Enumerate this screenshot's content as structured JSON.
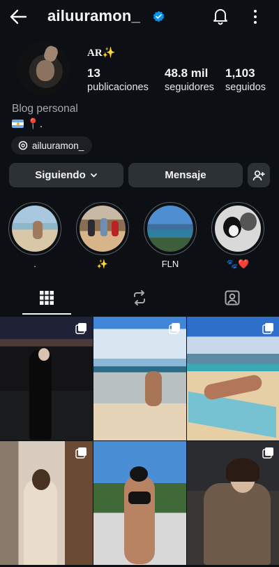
{
  "header": {
    "username": "ailuuramon_",
    "icons": [
      "back-arrow-icon",
      "verified-badge-icon",
      "bell-icon",
      "more-vertical-icon"
    ]
  },
  "profile": {
    "display_name": "AR✨",
    "stats": [
      {
        "value": "13",
        "label": "publicaciones"
      },
      {
        "value": "48.8 mil",
        "label": "seguidores"
      },
      {
        "value": "1,103",
        "label": "seguidos"
      }
    ],
    "category": "Blog personal",
    "bio_text": "📍.",
    "threads_handle": "ailuuramon_"
  },
  "actions": {
    "following_label": "Siguiendo",
    "message_label": "Mensaje"
  },
  "highlights": [
    {
      "label": "."
    },
    {
      "label": "✨"
    },
    {
      "label": "FLN"
    },
    {
      "label": "🐾❤️"
    }
  ],
  "tabs": [
    "grid-icon",
    "reels-icon",
    "tagged-icon"
  ],
  "posts_count_visible": 6,
  "colors": {
    "background": "#0c1014",
    "button": "#2c3136",
    "verified": "#0095f6",
    "secondary_text": "#a8a8a8"
  }
}
